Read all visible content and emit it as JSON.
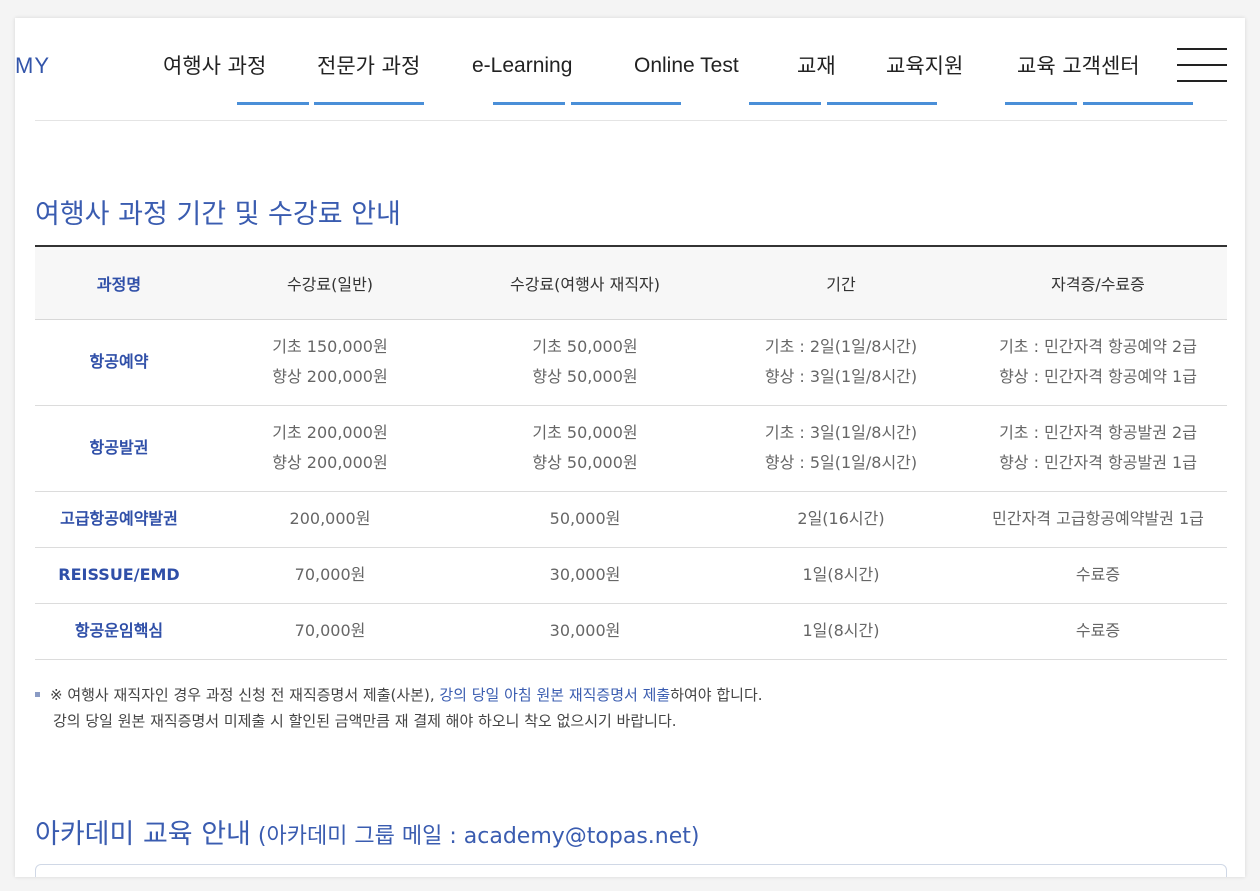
{
  "header": {
    "logo_text": "MY",
    "nav": [
      {
        "label": "여행사 과정"
      },
      {
        "label": "전문가 과정"
      },
      {
        "label": "e-Learning"
      },
      {
        "label": "Online Test"
      },
      {
        "label": "교재"
      },
      {
        "label": "교육지원"
      },
      {
        "label": "교육 고객센터"
      }
    ],
    "menu_icon": "hamburger-menu-icon"
  },
  "section": {
    "title": "여행사 과정 기간 및 수강료 안내"
  },
  "table": {
    "headers": [
      "과정명",
      "수강료(일반)",
      "수강료(여행사 재직자)",
      "기간",
      "자격증/수료증"
    ],
    "rows": [
      {
        "course": "항공예약",
        "fee_general": [
          "기초 150,000원",
          "향상 200,000원"
        ],
        "fee_agency": [
          "기초 50,000원",
          "향상 50,000원"
        ],
        "period": [
          "기초 : 2일(1일/8시간)",
          "향상 : 3일(1일/8시간)"
        ],
        "certificate": [
          "기초 : 민간자격 항공예약 2급",
          "향상 : 민간자격 항공예약 1급"
        ]
      },
      {
        "course": "항공발권",
        "fee_general": [
          "기초 200,000원",
          "향상 200,000원"
        ],
        "fee_agency": [
          "기초 50,000원",
          "향상 50,000원"
        ],
        "period": [
          "기초 : 3일(1일/8시간)",
          "향상 : 5일(1일/8시간)"
        ],
        "certificate": [
          "기초 : 민간자격 항공발권 2급",
          "향상 : 민간자격 항공발권 1급"
        ]
      },
      {
        "course": "고급항공예약발권",
        "fee_general": [
          "200,000원"
        ],
        "fee_agency": [
          "50,000원"
        ],
        "period": [
          "2일(16시간)"
        ],
        "certificate": [
          "민간자격 고급항공예약발권 1급"
        ]
      },
      {
        "course": "REISSUE/EMD",
        "fee_general": [
          "70,000원"
        ],
        "fee_agency": [
          "30,000원"
        ],
        "period": [
          "1일(8시간)"
        ],
        "certificate": [
          "수료증"
        ]
      },
      {
        "course": "항공운임핵심",
        "fee_general": [
          "70,000원"
        ],
        "fee_agency": [
          "30,000원"
        ],
        "period": [
          "1일(8시간)"
        ],
        "certificate": [
          "수료증"
        ]
      }
    ]
  },
  "note": {
    "line1_prefix": "※ 여행사 재직자인 경우 과정 신청 전 재직증명서 제출(사본), ",
    "line1_highlight": "강의 당일 아침 원본 재직증명서 제출",
    "line1_suffix": "하여야 합니다.",
    "line2": "강의 당일 원본 재직증명서 미제출 시 할인된 금액만큼 재 결제 해야 하오니 착오 없으시기 바랍니다."
  },
  "academy": {
    "title": "아카데미 교육 안내",
    "subtitle": " (아카데미 그룹 메일 : academy@topas.net)"
  },
  "colors": {
    "accent": "#3a5cb0",
    "nav_underline": "#4a8fd8",
    "table_header_bg": "#f7f7f7"
  }
}
